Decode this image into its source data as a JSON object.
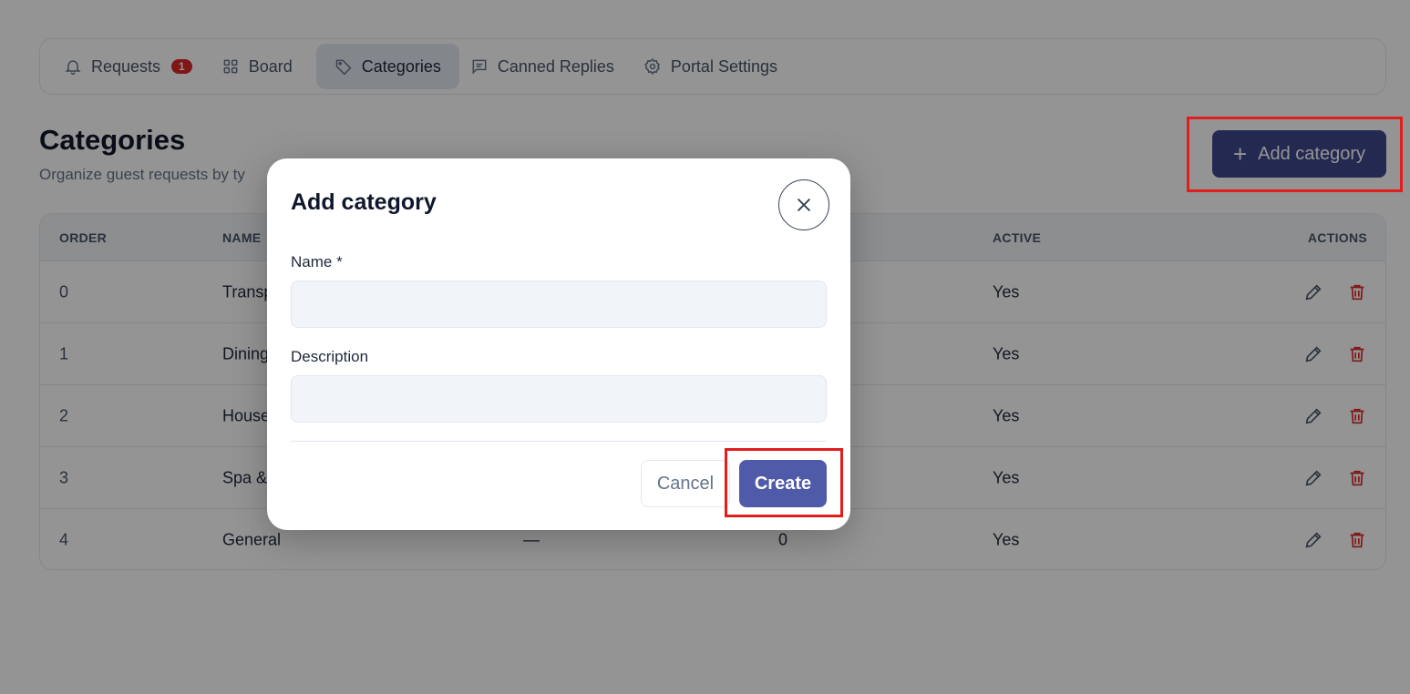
{
  "tabs": [
    {
      "label": "Requests",
      "icon": "bell-icon",
      "badge": "1"
    },
    {
      "label": "Board",
      "icon": "grid-icon"
    },
    {
      "label": "Categories",
      "icon": "tag-icon",
      "active": true
    },
    {
      "label": "Canned Replies",
      "icon": "message-icon"
    },
    {
      "label": "Portal Settings",
      "icon": "gear-icon"
    }
  ],
  "header": {
    "title": "Categories",
    "subtitle": "Organize guest requests by ty",
    "add_button": "Add category"
  },
  "table": {
    "columns": {
      "order": "ORDER",
      "name": "NAME",
      "active": "ACTIVE",
      "actions": "ACTIONS"
    },
    "rows": [
      {
        "order": "0",
        "name": "Transp",
        "desc": "",
        "count": "",
        "active": "Yes"
      },
      {
        "order": "1",
        "name": "Dining",
        "desc": "",
        "count": "",
        "active": "Yes"
      },
      {
        "order": "2",
        "name": "House",
        "desc": "",
        "count": "",
        "active": "Yes"
      },
      {
        "order": "3",
        "name": "Spa &",
        "desc": "",
        "count": "",
        "active": "Yes"
      },
      {
        "order": "4",
        "name": "General",
        "desc": "—",
        "count": "0",
        "active": "Yes"
      }
    ]
  },
  "modal": {
    "title": "Add category",
    "name_label": "Name *",
    "name_value": "",
    "description_label": "Description",
    "description_value": "",
    "cancel_label": "Cancel",
    "create_label": "Create"
  },
  "colors": {
    "primary": "#3e478d",
    "create": "#4f5aa8",
    "badge": "#dc2626",
    "highlight": "#e11d1d"
  }
}
